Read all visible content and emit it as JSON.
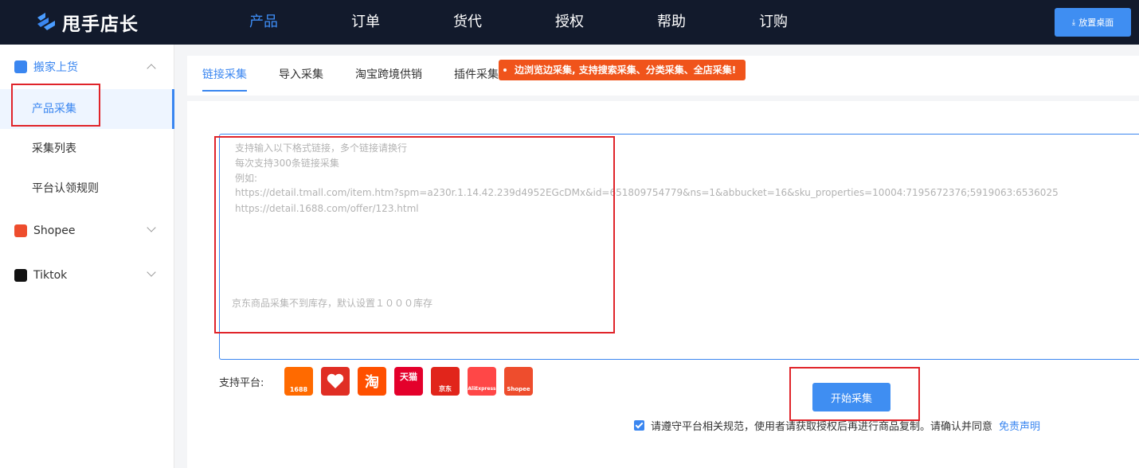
{
  "app": {
    "name": "甩手店长"
  },
  "nav": [
    "产品",
    "订单",
    "货代",
    "授权",
    "帮助",
    "订购"
  ],
  "header": {
    "pin_label": "放置桌面"
  },
  "sidebar": {
    "groups": [
      {
        "label": "搬家上货",
        "items": [
          "产品采集",
          "采集列表",
          "平台认领规则"
        ]
      },
      {
        "label": "Shopee"
      },
      {
        "label": "Tiktok"
      }
    ]
  },
  "tabs": [
    "链接采集",
    "导入采集",
    "淘宝跨境供销",
    "插件采集"
  ],
  "promo": "边浏览边采集, 支持搜索采集、分类采集、全店采集!",
  "placeholder": {
    "lines": [
      "支持输入以下格式链接，多个链接请换行",
      "每次支持300条链接采集",
      "例如:",
      "https://detail.tmall.com/item.htm?spm=a230r.1.14.42.239d4952EGcDMx&id=651809754779&ns=1&abbucket=16&sku_properties=10004:7195672376;5919063:6536025",
      "https://detail.1688.com/offer/123.html"
    ],
    "note": "京东商品采集不到库存，默认设置１０００库存"
  },
  "platforms": {
    "label": "支持平台:",
    "items": [
      {
        "icon": "1688-icon",
        "color": "#ff6a00",
        "text": "1688"
      },
      {
        "icon": "pinduoduo-icon",
        "color": "#e02e24",
        "text": ""
      },
      {
        "icon": "taobao-icon",
        "color": "#ff5000",
        "text": "淘"
      },
      {
        "icon": "tmall-icon",
        "color": "#e4002b",
        "text": "天猫"
      },
      {
        "icon": "jd-icon",
        "color": "#e1251b",
        "text": "京东"
      },
      {
        "icon": "aliexpress-icon",
        "color": "#ff4747",
        "text": "AliExpress"
      },
      {
        "icon": "shopee-icon",
        "color": "#ee4d2d",
        "text": "Shopee"
      }
    ]
  },
  "actions": {
    "start": "开始采集"
  },
  "agreement": {
    "text": "请遵守平台相关规范，使用者请获取授权后再进行商品复制。请确认并同意",
    "link": "免责声明"
  },
  "colors": {
    "accent": "#3a86f0",
    "topbar": "#121a2c",
    "promo": "#f0541b",
    "highlight": "#e0242a"
  }
}
